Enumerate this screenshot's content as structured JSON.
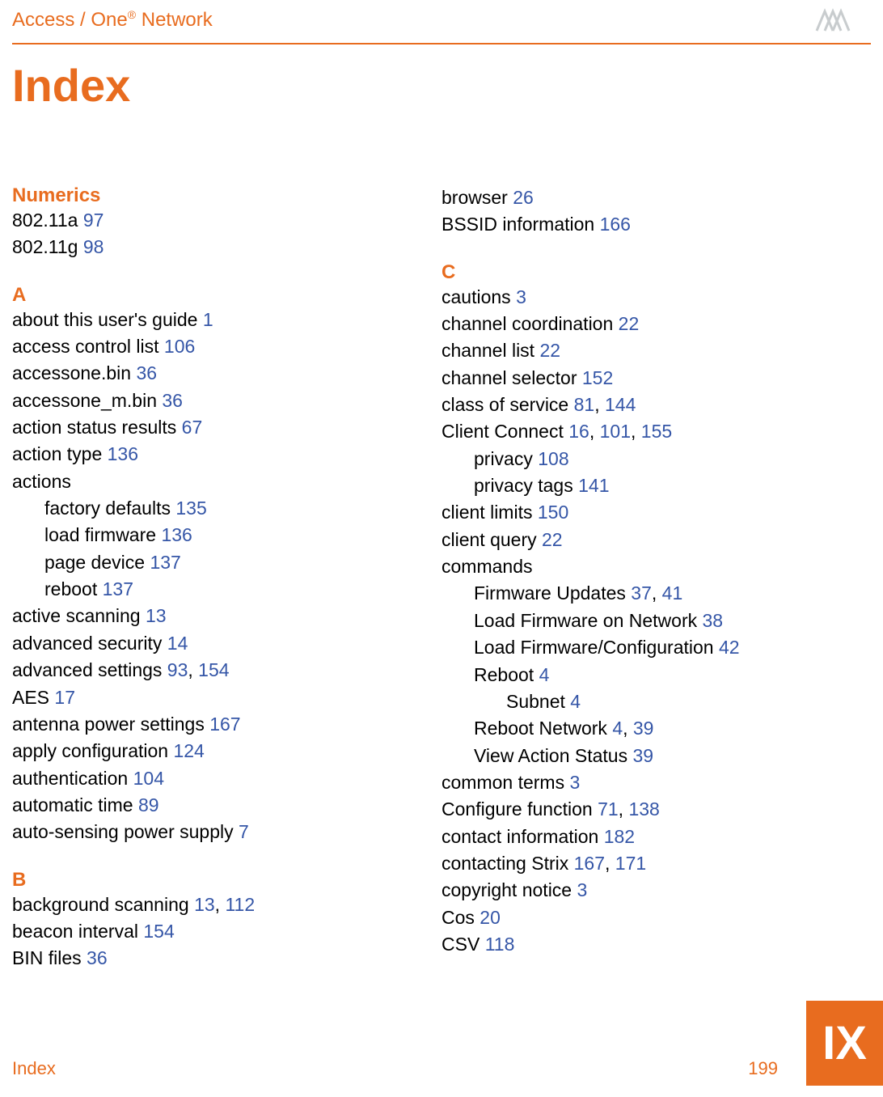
{
  "header": {
    "title_pre": "Access / One",
    "title_sup": "®",
    "title_post": " Network"
  },
  "page_title": "Index",
  "footer": {
    "label": "Index",
    "page": "199"
  },
  "tab": "IX",
  "left": {
    "numerics_head": "Numerics",
    "n1": "802.11a ",
    "n1p": "97",
    "n2": "802.11g ",
    "n2p": "98",
    "a_head": "A",
    "a": [
      {
        "t": "about this user's guide ",
        "p": "1"
      },
      {
        "t": "access control list ",
        "p": "106"
      },
      {
        "t": "accessone.bin ",
        "p": "36"
      },
      {
        "t": "accessone_m.bin ",
        "p": "36"
      },
      {
        "t": "action status results ",
        "p": "67"
      },
      {
        "t": "action type ",
        "p": "136"
      }
    ],
    "actions_label": "actions",
    "actions": [
      {
        "t": "factory defaults ",
        "p": "135"
      },
      {
        "t": "load firmware ",
        "p": "136"
      },
      {
        "t": "page device ",
        "p": "137"
      },
      {
        "t": "reboot ",
        "p": "137"
      }
    ],
    "a2": [
      {
        "t": "active scanning ",
        "p": "13"
      },
      {
        "t": "advanced security ",
        "p": "14"
      }
    ],
    "adv_set_t": "advanced settings ",
    "adv_set_p1": "93",
    "adv_set_p2": "154",
    "a3": [
      {
        "t": "AES ",
        "p": "17"
      },
      {
        "t": "antenna power settings ",
        "p": "167"
      },
      {
        "t": "apply configuration ",
        "p": "124"
      },
      {
        "t": "authentication ",
        "p": "104"
      },
      {
        "t": "automatic time ",
        "p": "89"
      },
      {
        "t": "auto-sensing power supply ",
        "p": "7"
      }
    ],
    "b_head": "B",
    "bg_t": "background scanning ",
    "bg_p1": "13",
    "bg_p2": "112",
    "b": [
      {
        "t": "beacon interval ",
        "p": "154"
      },
      {
        "t": "BIN files ",
        "p": "36"
      }
    ]
  },
  "right": {
    "r_top": [
      {
        "t": "browser ",
        "p": "26"
      },
      {
        "t": "BSSID information ",
        "p": "166"
      }
    ],
    "c_head": "C",
    "c1": [
      {
        "t": "cautions ",
        "p": "3"
      },
      {
        "t": "channel coordination ",
        "p": "22"
      },
      {
        "t": "channel list ",
        "p": "22"
      },
      {
        "t": "channel selector ",
        "p": "152"
      }
    ],
    "cos_t": "class of service ",
    "cos_p1": "81",
    "cos_p2": "144",
    "cc_t": "Client Connect ",
    "cc_p1": "16",
    "cc_p2": "101",
    "cc_p3": "155",
    "cc_sub": [
      {
        "t": "privacy ",
        "p": "108"
      },
      {
        "t": "privacy tags ",
        "p": "141"
      }
    ],
    "c2": [
      {
        "t": "client limits ",
        "p": "150"
      },
      {
        "t": "client query ",
        "p": "22"
      }
    ],
    "commands_label": "commands",
    "cmd_fw_t": "Firmware Updates ",
    "cmd_fw_p1": "37",
    "cmd_fw_p2": "41",
    "cmds": [
      {
        "t": "Load Firmware on Network ",
        "p": "38"
      },
      {
        "t": "Load Firmware/Configuration ",
        "p": "42"
      },
      {
        "t": "Reboot ",
        "p": "4"
      }
    ],
    "subnet_t": "Subnet ",
    "subnet_p": "4",
    "rn_t": "Reboot Network ",
    "rn_p1": "4",
    "rn_p2": "39",
    "vas_t": "View Action Status ",
    "vas_p": "39",
    "c3_common_t": "common terms ",
    "c3_common_p": "3",
    "cfg_t": "Configure function ",
    "cfg_p1": "71",
    "cfg_p2": "138",
    "ci_t": "contact information ",
    "ci_p": "182",
    "cs_t": "contacting Strix ",
    "cs_p1": "167",
    "cs_p2": "171",
    "c4": [
      {
        "t": "copyright notice ",
        "p": "3"
      },
      {
        "t": "Cos ",
        "p": "20"
      },
      {
        "t": "CSV ",
        "p": "118"
      }
    ]
  }
}
